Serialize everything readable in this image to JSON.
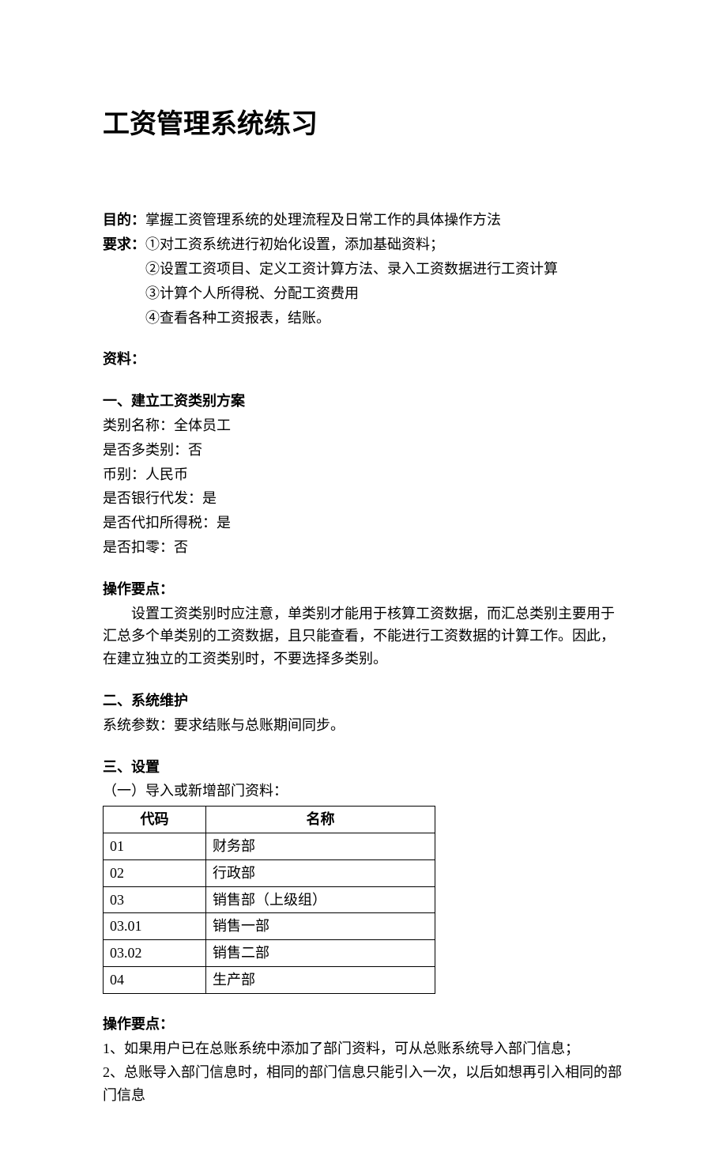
{
  "title": "工资管理系统练习",
  "purpose": {
    "label": "目的：",
    "text": "掌握工资管理系统的处理流程及日常工作的具体操作方法"
  },
  "require": {
    "label": "要求：",
    "line1": "①对工资系统进行初始化设置，添加基础资料；",
    "line2": "②设置工资项目、定义工资计算方法、录入工资数据进行工资计算",
    "line3": "③计算个人所得税、分配工资费用",
    "line4": "④查看各种工资报表，结账。"
  },
  "materials_label": "资料：",
  "s1": {
    "heading": "一、建立工资类别方案",
    "l1": "类别名称：全体员工",
    "l2": "是否多类别：否",
    "l3": "币别：人民币",
    "l4": "是否银行代发：是",
    "l5": "是否代扣所得税：是",
    "l6": "是否扣零：否"
  },
  "opkey1": {
    "label": "操作要点：",
    "text": "设置工资类别时应注意，单类别才能用于核算工资数据，而汇总类别主要用于汇总多个单类别的工资数据，且只能查看，不能进行工资数据的计算工作。因此，在建立独立的工资类别时，不要选择多类别。"
  },
  "s2": {
    "heading": "二、系统维护",
    "text": "系统参数：要求结账与总账期间同步。"
  },
  "s3": {
    "heading": "三、设置",
    "sub": "（一）导入或新增部门资料：",
    "th_code": "代码",
    "th_name": "名称",
    "rows": [
      {
        "code": "01",
        "name": "财务部"
      },
      {
        "code": "02",
        "name": "行政部"
      },
      {
        "code": "03",
        "name": "销售部（上级组）"
      },
      {
        "code": "03.01",
        "name": "销售一部"
      },
      {
        "code": "03.02",
        "name": "销售二部"
      },
      {
        "code": "04",
        "name": "生产部"
      }
    ]
  },
  "opkey2": {
    "label": "操作要点：",
    "l1": "1、如果用户已在总账系统中添加了部门资料，可从总账系统导入部门信息；",
    "l2": "2、总账导入部门信息时，相同的部门信息只能引入一次，以后如想再引入相同的部门信息"
  }
}
